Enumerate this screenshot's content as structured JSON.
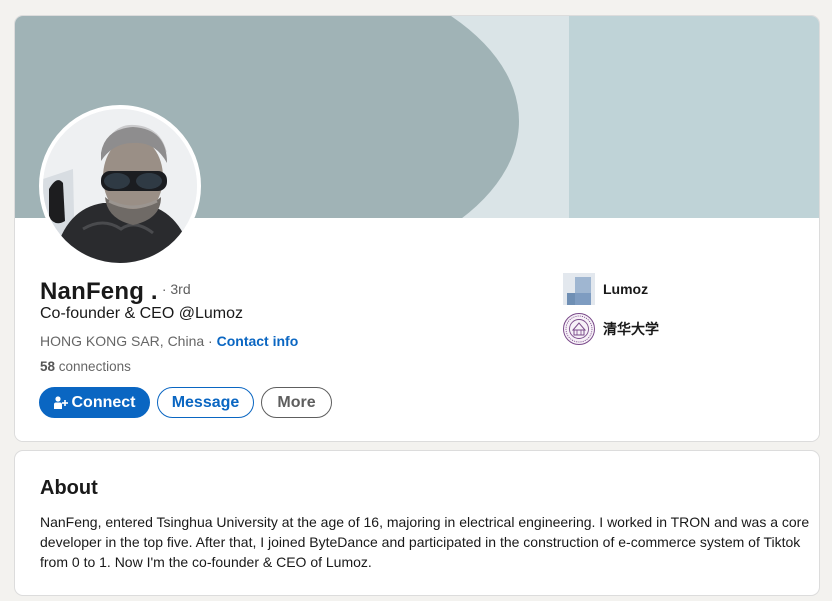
{
  "profile": {
    "name": "NanFeng .",
    "degree": "· 3rd",
    "headline": "Co-founder & CEO @Lumoz",
    "location": "HONG KONG SAR, China",
    "location_separator": " · ",
    "contact_info_label": "Contact info",
    "connections_count": "58",
    "connections_label": " connections",
    "avatar_alt": "NanFeng profile photo"
  },
  "actions": {
    "connect_label": "Connect",
    "message_label": "Message",
    "more_label": "More"
  },
  "organizations": [
    {
      "name": "Lumoz",
      "icon": "lumoz-logo"
    },
    {
      "name": "清华大学",
      "icon": "tsinghua-seal"
    }
  ],
  "about": {
    "title": "About",
    "text": "NanFeng, entered Tsinghua University at the age of 16, majoring in electrical engineering. I worked in TRON and was a core developer in the top five. After that, I joined ByteDance and participated in the construction of e-commerce system of Tiktok from 0 to 1. Now I'm the co-founder & CEO of Lumoz."
  },
  "colors": {
    "accent": "#0a66c2",
    "banner_dark": "#a0b3b6",
    "banner_light": "#dae4e7",
    "banner_right": "#bfd3d7",
    "page_bg": "#f3f2ef"
  }
}
